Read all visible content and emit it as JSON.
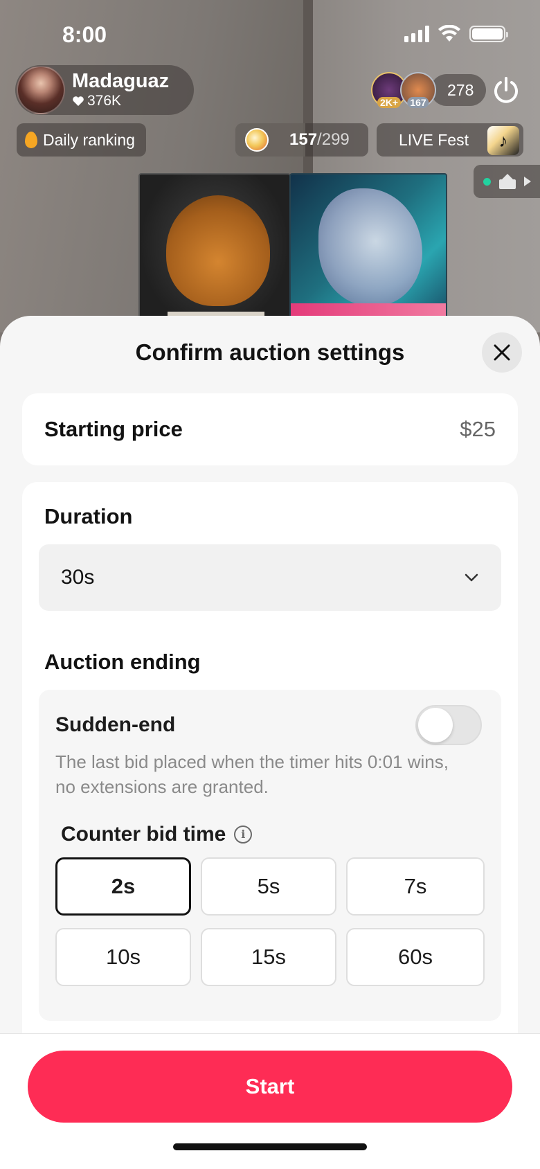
{
  "status_bar": {
    "time": "8:00"
  },
  "host": {
    "name": "Madaguaz",
    "likes": "376K"
  },
  "viewers": {
    "badge_1": "2K+",
    "badge_2": "167",
    "count": "278"
  },
  "daily_ranking": {
    "label": "Daily ranking"
  },
  "coins": {
    "current": "157",
    "total": "/299",
    "progress": 0.525
  },
  "live_fest": {
    "label": "LIVE Fest"
  },
  "sheet": {
    "title": "Confirm auction settings",
    "starting_price": {
      "label": "Starting price",
      "value": "$25"
    },
    "duration": {
      "label": "Duration",
      "selected": "30s"
    },
    "auction_ending": {
      "label": "Auction ending",
      "sudden_end": {
        "title": "Sudden-end",
        "enabled": false,
        "description": "The last bid placed when the timer hits 0:01 wins, no extensions are granted."
      },
      "counter_bid": {
        "title": "Counter bid time",
        "options": [
          "2s",
          "5s",
          "7s",
          "10s",
          "15s",
          "60s"
        ],
        "selected": "2s"
      }
    },
    "start_label": "Start"
  },
  "colors": {
    "accent": "#fe2c55",
    "sheet_bg": "#f6f6f6",
    "card_bg": "#ffffff"
  },
  "icons": [
    "signal-icon",
    "wifi-icon",
    "battery-icon",
    "heart-icon",
    "power-icon",
    "flame-icon",
    "coin-icon",
    "music-note-icon",
    "home-icon",
    "close-icon",
    "chevron-down-icon",
    "info-icon"
  ]
}
